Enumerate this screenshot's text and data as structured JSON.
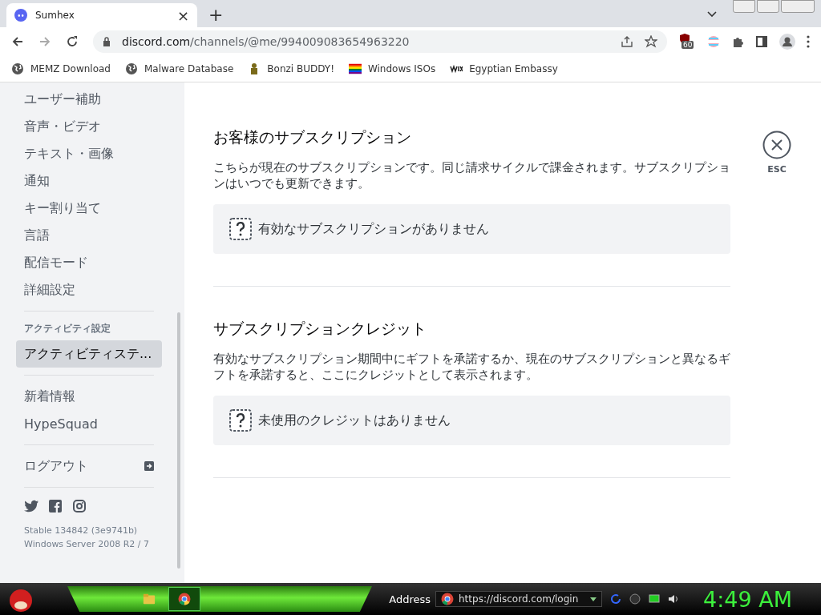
{
  "browser": {
    "tab": {
      "title": "Sumhex",
      "close": "×"
    },
    "new_tab": "+",
    "url": {
      "host": "discord.com",
      "path": "/channels/@me/994009083654963220"
    },
    "extension_badge": "60",
    "bookmarks": [
      {
        "label": "MEMZ Download",
        "kind": "globe"
      },
      {
        "label": "Malware Database",
        "kind": "globe"
      },
      {
        "label": "Bonzi BUDDY!",
        "kind": "figure"
      },
      {
        "label": "Windows ISOs",
        "kind": "rainbow"
      },
      {
        "label": "Egyptian Embassy",
        "kind": "wix"
      }
    ]
  },
  "sidebar": {
    "groups": [
      {
        "items": [
          {
            "label": "ユーザー補助",
            "selected": false
          },
          {
            "label": "音声・ビデオ",
            "selected": false
          },
          {
            "label": "テキスト・画像",
            "selected": false
          },
          {
            "label": "通知",
            "selected": false
          },
          {
            "label": "キー割り当て",
            "selected": false
          },
          {
            "label": "言語",
            "selected": false
          },
          {
            "label": "配信モード",
            "selected": false
          },
          {
            "label": "詳細設定",
            "selected": false
          }
        ]
      },
      {
        "header": "アクティビティ設定",
        "items": [
          {
            "label": "アクティビティステ...",
            "selected": true
          }
        ]
      },
      {
        "items": [
          {
            "label": "新着情報",
            "selected": false
          },
          {
            "label": "HypeSquad",
            "selected": false
          }
        ]
      },
      {
        "items": [
          {
            "label": "ログアウト",
            "selected": false,
            "kind": "logout"
          }
        ]
      }
    ],
    "version": [
      "Stable 134842 (3e9741b)",
      "Windows Server 2008 R2 / 7"
    ]
  },
  "sections": [
    {
      "title": "お客様のサブスクリプション",
      "description": "こちらが現在のサブスクリプションです。同じ請求サイクルで課金されます。サブスクリプションはいつでも更新できます。",
      "empty": "有効なサブスクリプションがありません"
    },
    {
      "title": "サブスクリプションクレジット",
      "description": "有効なサブスクリプション期間中にギフトを承諾するか、現在のサブスクリプションと異なるギフトを承諾すると、ここにクレジットとして表示されます。",
      "empty": "未使用のクレジットはありません"
    }
  ],
  "close_label": "ESC",
  "taskbar": {
    "address_label": "Address",
    "address": "https://discord.com/login",
    "clock": "4:49 AM"
  }
}
